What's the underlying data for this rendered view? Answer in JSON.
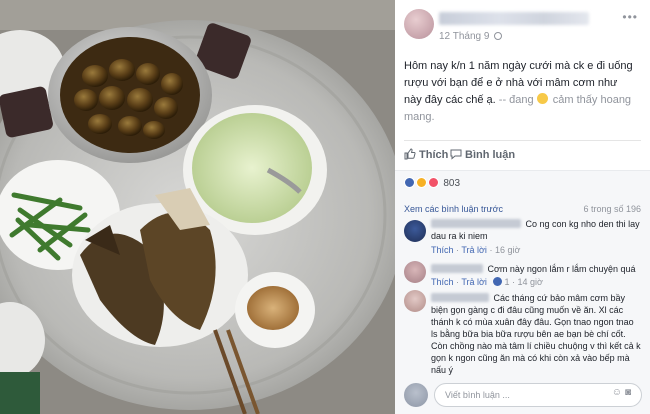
{
  "photo": {
    "description_icon": "food-photo"
  },
  "post": {
    "time": "12 Tháng 9",
    "text": "Hôm nay k/n 1 năm ngày cưới mà ck e đi uống rượu với bạn để e ở nhà với mâm cơm như này đây các chế ạ.",
    "feeling_prefix": "-- đang",
    "feeling": "cảm thấy hoang mang.",
    "actions": {
      "like": "Thích",
      "comment": "Bình luận"
    },
    "reactions_count": "803"
  },
  "comments_section": {
    "view_previous": "Xem các bình luận trước",
    "count": "6 trong số 196",
    "comments": [
      {
        "text": "Co ng con kg nho den thi lay dau ra ki niem",
        "like": "Thích",
        "reply": "Trả lời",
        "time": "16 giờ",
        "likes": ""
      },
      {
        "text": "Cơm này ngon lắm r lắm chuyện quá",
        "like": "Thích",
        "reply": "Trả lời",
        "time": "14 giờ",
        "likes": "1"
      },
      {
        "text": "Các tháng cứ bảo mâm cơm bầy biện gọn gàng c đi đâu cũng muốn về ăn. Xl các thánh k có mùa xuân đây đâu. Gọn tnao ngon tnao ls bằng bữa bia bữa rượu bên ae bạn bè chí cốt. Còn chồng nào mà tâm lí chiều chuộng v thì kết cả k gọn k ngon cũng ăn mà có khi còn xả vào bếp mà nấu ý"
      }
    ],
    "write_placeholder": "Viết bình luận ..."
  },
  "colors": {
    "fb_blue": "#4267b2",
    "link_blue": "#385898",
    "text": "#1d2129",
    "meta": "#90949c"
  }
}
